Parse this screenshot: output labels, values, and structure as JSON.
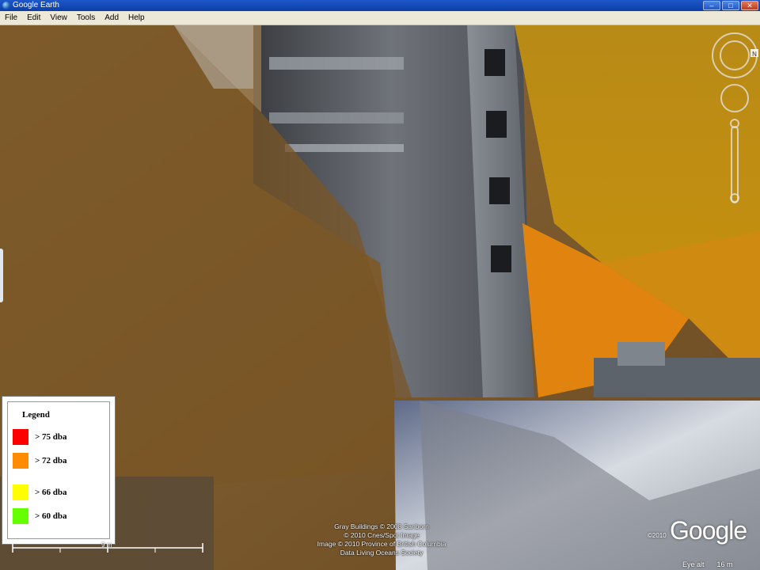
{
  "window": {
    "title": "Google Earth"
  },
  "menu": [
    "File",
    "Edit",
    "View",
    "Tools",
    "Add",
    "Help"
  ],
  "legend": {
    "title": "Legend",
    "items": [
      {
        "label": "> 75 dba",
        "color": "#ff0000"
      },
      {
        "label": "> 72 dba",
        "color": "#ff8c00"
      },
      {
        "label": "> 66 dba",
        "color": "#ffff00"
      },
      {
        "label": "> 60 dba",
        "color": "#66ff00"
      }
    ]
  },
  "scale": {
    "label": "9 m"
  },
  "attribution": [
    "Gray Buildings © 2008 Sanborn",
    "© 2010 Cnes/Spot Image",
    "Image © 2010 Province of British Columbia",
    "Data Living Oceans Society"
  ],
  "brand": {
    "year": "©2010",
    "logo": "Google"
  },
  "status": {
    "eye_alt_label": "Eye alt",
    "eye_alt_value": "16 m"
  },
  "icons": {
    "app": "globe-icon",
    "north": "compass-icon",
    "look": "look-joystick-icon",
    "move": "move-joystick-icon",
    "zoom": "zoom-slider-icon"
  }
}
